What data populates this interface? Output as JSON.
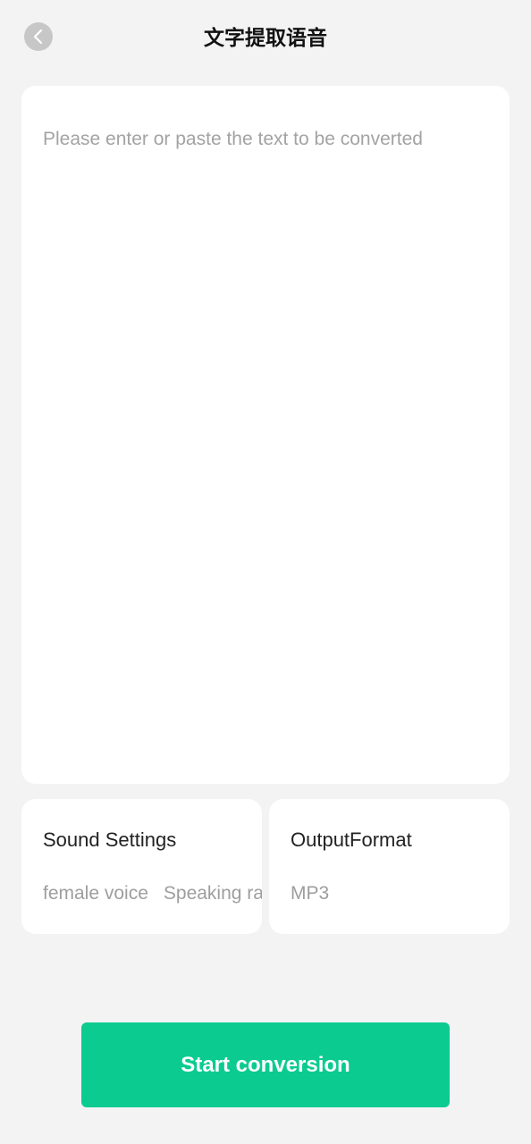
{
  "header": {
    "title": "文字提取语音",
    "back_icon": "chevron-left-icon"
  },
  "text_input": {
    "value": "",
    "placeholder": "Please enter or paste the text to be converted"
  },
  "sound_settings": {
    "title": "Sound Settings",
    "voice": "female voice",
    "rate_label": "Speaking ra"
  },
  "output_format": {
    "title": "OutputFormat",
    "value": "MP3"
  },
  "start_button": {
    "label": "Start conversion"
  },
  "colors": {
    "background": "#f3f3f3",
    "accent": "#0ccb90",
    "card": "#ffffff",
    "placeholder": "#a3a3a3"
  }
}
